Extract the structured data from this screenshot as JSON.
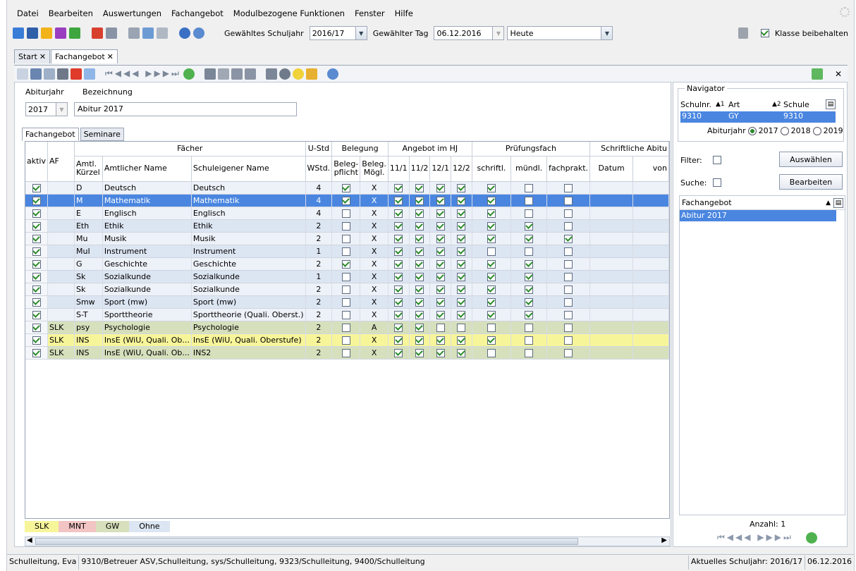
{
  "menu": [
    "Datei",
    "Bearbeiten",
    "Auswertungen",
    "Fachangebot",
    "Modulbezogene Funktionen",
    "Fenster",
    "Hilfe"
  ],
  "toolbar": {
    "schuljahr_label": "Gewähltes Schuljahr",
    "schuljahr_value": "2016/17",
    "tag_label": "Gewählter Tag",
    "tag_value": "06.12.2016",
    "heute_value": "Heute",
    "klasse_label": "Klasse beibehalten"
  },
  "tabs": [
    "Start",
    "Fachangebot"
  ],
  "form": {
    "abiturjahr_label": "Abiturjahr",
    "abiturjahr_value": "2017",
    "bezeichnung_label": "Bezeichnung",
    "bezeichnung_value": "Abitur 2017",
    "subtabs": [
      "Fachangebot",
      "Seminare"
    ]
  },
  "grid": {
    "group_headers": {
      "faecher": "Fächer",
      "ustd": "U-Std",
      "belegung": "Belegung",
      "angebot": "Angebot im HJ",
      "pruefungsfach": "Prüfungsfach",
      "schriftliche": "Schriftliche Abitu"
    },
    "col_headers": {
      "aktiv": "aktiv",
      "af": "AF",
      "kuerzel": "Amtl. Kürzel",
      "amtl_name": "Amtlicher Name",
      "schul_name": "Schuleigener Name",
      "wstd": "WStd.",
      "belegpflicht": "Beleg- pflicht",
      "beleg_moegl": "Beleg. Mögl.",
      "h111": "11/1",
      "h112": "11/2",
      "h121": "12/1",
      "h122": "12/2",
      "schriftl": "schriftl.",
      "muendl": "mündl.",
      "fachprakt": "fachprakt.",
      "datum": "Datum",
      "von": "von"
    },
    "rows": [
      {
        "style": "r-alt",
        "aktiv": true,
        "af": "",
        "k": "D",
        "n": "Deutsch",
        "s": "Deutsch",
        "w": "4",
        "bp": true,
        "bm": "X",
        "h": [
          true,
          true,
          true,
          true
        ],
        "sc": true,
        "mu": false,
        "fp": false
      },
      {
        "style": "r-sel",
        "aktiv": true,
        "af": "",
        "k": "M",
        "n": "Mathematik",
        "s": "Mathematik",
        "w": "4",
        "bp": true,
        "bm": "X",
        "h": [
          true,
          true,
          true,
          true
        ],
        "sc": true,
        "mu": false,
        "fp": false
      },
      {
        "style": "r-alt",
        "aktiv": true,
        "af": "",
        "k": "E",
        "n": "Englisch",
        "s": "Englisch",
        "w": "4",
        "bp": false,
        "bm": "X",
        "h": [
          true,
          true,
          true,
          true
        ],
        "sc": true,
        "mu": false,
        "fp": false
      },
      {
        "style": "r-none",
        "aktiv": true,
        "af": "",
        "k": "Eth",
        "n": "Ethik",
        "s": "Ethik",
        "w": "2",
        "bp": false,
        "bm": "X",
        "h": [
          true,
          true,
          true,
          true
        ],
        "sc": true,
        "mu": true,
        "fp": false
      },
      {
        "style": "r-alt",
        "aktiv": true,
        "af": "",
        "k": "Mu",
        "n": "Musik",
        "s": "Musik",
        "w": "2",
        "bp": false,
        "bm": "X",
        "h": [
          true,
          true,
          true,
          true
        ],
        "sc": true,
        "mu": true,
        "fp": true
      },
      {
        "style": "r-none",
        "aktiv": true,
        "af": "",
        "k": "MuI",
        "n": "Instrument",
        "s": "Instrument",
        "w": "1",
        "bp": false,
        "bm": "X",
        "h": [
          true,
          true,
          true,
          true
        ],
        "sc": false,
        "mu": false,
        "fp": false
      },
      {
        "style": "r-alt",
        "aktiv": true,
        "af": "",
        "k": "G",
        "n": "Geschichte",
        "s": "Geschichte",
        "w": "2",
        "bp": true,
        "bm": "X",
        "h": [
          true,
          true,
          true,
          true
        ],
        "sc": true,
        "mu": true,
        "fp": false
      },
      {
        "style": "r-none",
        "aktiv": true,
        "af": "",
        "k": "Sk",
        "n": "Sozialkunde",
        "s": "Sozialkunde",
        "w": "1",
        "bp": false,
        "bm": "X",
        "h": [
          true,
          true,
          true,
          true
        ],
        "sc": true,
        "mu": true,
        "fp": false
      },
      {
        "style": "r-alt",
        "aktiv": true,
        "af": "",
        "k": "Sk",
        "n": "Sozialkunde",
        "s": "Sozialkunde",
        "w": "2",
        "bp": false,
        "bm": "X",
        "h": [
          true,
          true,
          true,
          true
        ],
        "sc": true,
        "mu": true,
        "fp": false
      },
      {
        "style": "r-none",
        "aktiv": true,
        "af": "",
        "k": "Smw",
        "n": "Sport (mw)",
        "s": "Sport (mw)",
        "w": "2",
        "bp": false,
        "bm": "X",
        "h": [
          true,
          true,
          true,
          true
        ],
        "sc": true,
        "mu": true,
        "fp": false
      },
      {
        "style": "r-alt",
        "aktiv": true,
        "af": "",
        "k": "S-T",
        "n": "Sporttheorie",
        "s": "Sporttheorie (Quali. Oberst.)",
        "w": "2",
        "bp": false,
        "bm": "X",
        "h": [
          true,
          true,
          true,
          true
        ],
        "sc": true,
        "mu": true,
        "fp": false
      },
      {
        "style": "r-slk",
        "aktiv": true,
        "af": "SLK",
        "k": "psy",
        "n": "Psychologie",
        "s": "Psychologie",
        "w": "2",
        "bp": false,
        "bm": "A",
        "h": [
          true,
          true,
          false,
          false
        ],
        "sc": false,
        "mu": false,
        "fp": false
      },
      {
        "style": "r-ins1",
        "aktiv": true,
        "af": "SLK",
        "k": "INS",
        "n": "InsE (WiU, Quali. Ob...",
        "s": "InsE (WiU, Quali. Oberstufe)",
        "w": "2",
        "bp": false,
        "bm": "X",
        "h": [
          true,
          true,
          true,
          true
        ],
        "sc": true,
        "mu": false,
        "fp": false
      },
      {
        "style": "r-ins2",
        "aktiv": true,
        "af": "SLK",
        "k": "INS",
        "n": "InsE (WiU, Quali. Ob...",
        "s": "INS2",
        "w": "2",
        "bp": false,
        "bm": "X",
        "h": [
          true,
          true,
          true,
          true
        ],
        "sc": false,
        "mu": false,
        "fp": false
      }
    ]
  },
  "legend": [
    {
      "label": "SLK",
      "color": "#f7f59a"
    },
    {
      "label": "MNT",
      "color": "#f2c4c4"
    },
    {
      "label": "GW",
      "color": "#d6e0bc"
    },
    {
      "label": "Ohne",
      "color": "#dce5f2"
    }
  ],
  "navigator": {
    "title": "Navigator",
    "col_schulnr": "Schulnr.",
    "col_art": "Art",
    "col_schule": "Schule",
    "sort1": "1",
    "sort2": "2",
    "row": {
      "schulnr": "9310",
      "art": "GY",
      "schule": "9310"
    },
    "abiturjahr_label": "Abiturjahr",
    "years": [
      "2017",
      "2018",
      "2019"
    ],
    "filter_label": "Filter:",
    "suche_label": "Suche:",
    "auswaehlen": "Auswählen",
    "bearbeiten": "Bearbeiten",
    "list_header": "Fachangebot",
    "list_item": "Abitur 2017",
    "anzahl": "Anzahl: 1"
  },
  "status": {
    "user": "Schulleitung, Eva",
    "roles": "9310/Betreuer ASV,Schulleitung, sys/Schulleitung, 9323/Schulleitung, 9400/Schulleitung",
    "aktuell": "Aktuelles Schuljahr: 2016/17",
    "date": "06.12.2016"
  },
  "colors": {
    "selection": "#4a86e0",
    "window": "#f0f0f0"
  }
}
